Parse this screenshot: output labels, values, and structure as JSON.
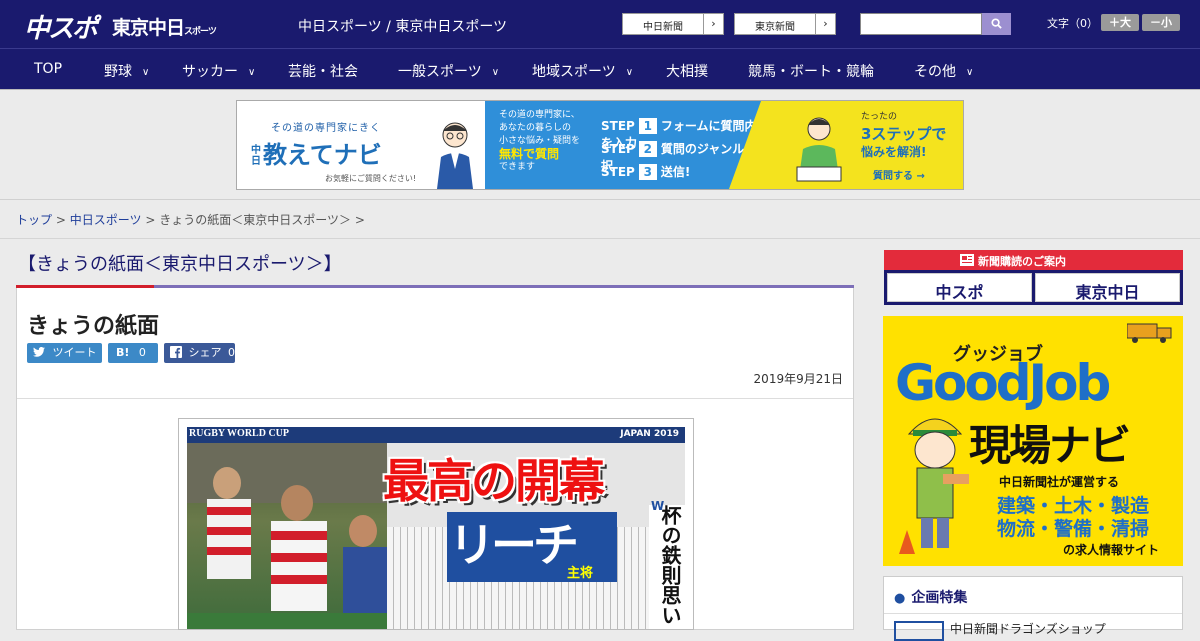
{
  "header": {
    "logo_chuspo": "中スポ",
    "logo_tokyo": "東京中日",
    "logo_tokyo_small": "スポーツ",
    "site_title": "中日スポーツ / 東京中日スポーツ",
    "links": [
      {
        "label": "中日新聞",
        "arrow": "›"
      },
      {
        "label": "東京新聞",
        "arrow": "›"
      }
    ],
    "search_placeholder": "",
    "search_icon": "search-icon",
    "fontsize_label": "文字（0）",
    "font_larger": "＋大",
    "font_smaller": "－小"
  },
  "nav": {
    "items": [
      {
        "label": "TOP",
        "dropdown": false
      },
      {
        "label": "野球",
        "dropdown": true
      },
      {
        "label": "サッカー",
        "dropdown": true
      },
      {
        "label": "芸能・社会",
        "dropdown": false
      },
      {
        "label": "一般スポーツ",
        "dropdown": true
      },
      {
        "label": "地域スポーツ",
        "dropdown": true
      },
      {
        "label": "大相撲",
        "dropdown": false
      },
      {
        "label": "競馬・ボート・競輪",
        "dropdown": false
      },
      {
        "label": "その他",
        "dropdown": true
      }
    ],
    "chevron": "∨"
  },
  "ad_banner": {
    "sub": "その道の専門家にきく",
    "main": "教えてナビ",
    "main_small": "中日",
    "note": "お気軽にご質問ください!",
    "mid_lines": [
      "その道の専門家に、",
      "あなたの暮らしの",
      "小さな悩み・疑問を"
    ],
    "mid_highlight": "無料で質問",
    "mid_tail": "できます",
    "steps": [
      {
        "label": "STEP",
        "num": "1",
        "text": "フォームに質問内容を入力"
      },
      {
        "label": "STEP",
        "num": "2",
        "text": "質問のジャンルを選択"
      },
      {
        "label": "STEP",
        "num": "3",
        "text": "送信!"
      }
    ],
    "right_t1": "たったの",
    "right_t2": "3ステップで",
    "right_t3": "悩みを解消!",
    "right_cta": "質問する →"
  },
  "breadcrumb": {
    "items": [
      {
        "label": "トップ",
        "link": true
      },
      {
        "label": "中日スポーツ",
        "link": true
      },
      {
        "label": "きょうの紙面＜東京中日スポーツ＞",
        "link": false
      }
    ],
    "separator": ">"
  },
  "section_title": "【きょうの紙面＜東京中日スポーツ＞】",
  "article": {
    "title": "きょうの紙面",
    "share": [
      {
        "icon": "twitter-icon",
        "label": "ツイート",
        "count": ""
      },
      {
        "icon": "hatena-icon",
        "label": "B!",
        "count": "0"
      },
      {
        "icon": "facebook-icon",
        "label": "シェア",
        "count": "0"
      }
    ],
    "date": "2019年9月21日",
    "paper": {
      "banner_left": "RUGBY WORLD CUP",
      "banner_right": "JAPAN 2019",
      "headline": "最高の開幕",
      "sub": "リーチ",
      "sub_small": "主将",
      "w_label": "W",
      "vertical": "杯の鉄則思い"
    }
  },
  "sidebar": {
    "subscription_header": "新聞購読のご案内",
    "subscription_buttons": [
      "中スポ",
      "東京中日"
    ],
    "ad": {
      "small": "グッジョブ",
      "main": "GoodJob",
      "navi": "現場ナビ",
      "line1": "中日新聞社が運営する",
      "line2": "建築・土木・製造",
      "line3": "物流・警備・清掃",
      "line4": "の求人情報サイト"
    },
    "feature_title": "企画特集",
    "feature_item": "中日新聞ドラゴンズショップ"
  },
  "colors": {
    "header_bg": "#1a1a6e",
    "accent_red": "#d21e2b",
    "link_blue": "#1f3e9a",
    "twitter": "#3c89c7",
    "facebook": "#3b5998"
  }
}
